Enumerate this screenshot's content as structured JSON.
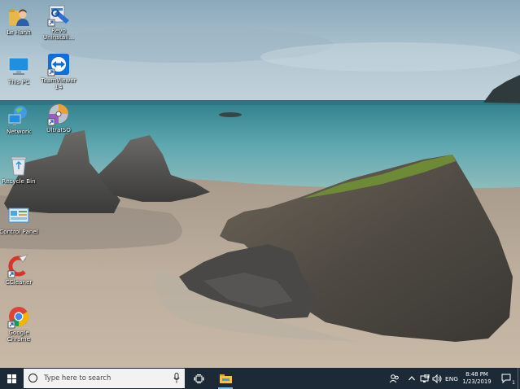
{
  "desktop": {
    "icons": [
      {
        "label": "Le Hanh",
        "icon": "user-folder-icon"
      },
      {
        "label": "Revo Uninstall...",
        "icon": "revo-uninstaller-icon"
      },
      {
        "label": "This PC",
        "icon": "computer-icon"
      },
      {
        "label": "TeamViewer 14",
        "icon": "teamviewer-icon"
      },
      {
        "label": "Network",
        "icon": "network-icon"
      },
      {
        "label": "UltraISO",
        "icon": "ultraiso-disc-icon"
      },
      {
        "label": "Recycle Bin",
        "icon": "recycle-bin-icon"
      },
      {
        "label": "Control Panel",
        "icon": "control-panel-icon"
      },
      {
        "label": "CCleaner",
        "icon": "ccleaner-icon"
      },
      {
        "label": "Google Chrome",
        "icon": "chrome-icon"
      }
    ]
  },
  "taskbar": {
    "search_placeholder": "Type here to search",
    "language": "ENG",
    "time": "8:48 PM",
    "date": "1/23/2019",
    "notification_count": "1"
  },
  "colors": {
    "taskbar": "#1b2a36",
    "sky": "#a9c1cf",
    "sea": "#4e9aa6",
    "sand": "#b9aa9a"
  }
}
